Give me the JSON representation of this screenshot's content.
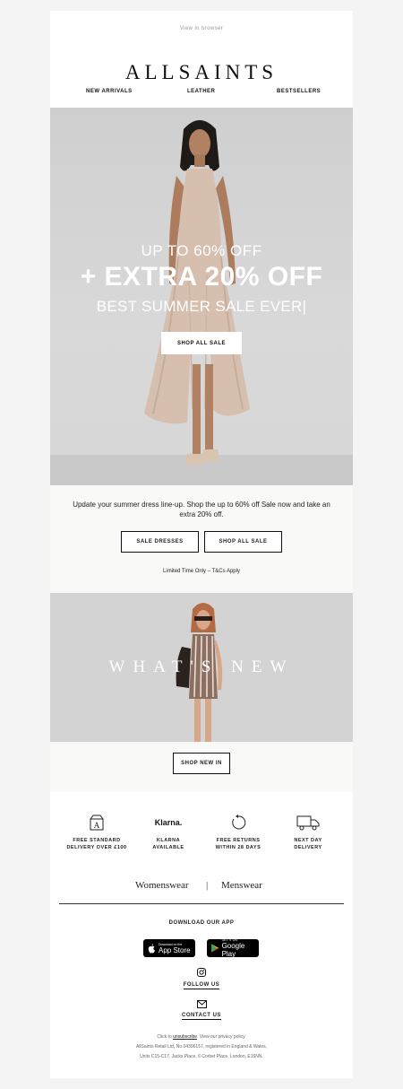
{
  "view_in_browser": "View in browser",
  "brand": "ALLSAINTS",
  "nav": [
    "NEW ARRIVALS",
    "LEATHER",
    "BESTSELLERS"
  ],
  "hero": {
    "line1": "UP TO 60% OFF",
    "line2": "+ EXTRA 20% OFF",
    "line3": "BEST SUMMER SALE EVER|",
    "cta": "SHOP ALL SALE"
  },
  "promo": {
    "copy": "Update your summer dress line-up. Shop the up to 60% off Sale now and take an extra 20% off.",
    "btn_dresses": "SALE DRESSES",
    "btn_all": "SHOP ALL SALE",
    "limited": "Limited Time Only – T&Cs Apply"
  },
  "whats_new": {
    "title": "WHAT'S NEW",
    "cta": "SHOP NEW IN"
  },
  "usps": [
    {
      "icon": "box-a-icon",
      "line1": "FREE STANDARD",
      "line2": "DELIVERY OVER £100"
    },
    {
      "icon": "klarna-logo",
      "logo_text": "Klarna.",
      "line1": "KLARNA",
      "line2": "AVAILABLE"
    },
    {
      "icon": "returns-icon",
      "line1": "FREE RETURNS",
      "line2": "WITHIN 28 DAYS"
    },
    {
      "icon": "truck-icon",
      "line1": "NEXT DAY",
      "line2": "DELIVERY"
    }
  ],
  "gender": {
    "women": "Womenswear",
    "divider": "|",
    "men": "Menswear"
  },
  "app": {
    "heading": "DOWNLOAD OUR APP",
    "appstore_small": "Download on the",
    "appstore_big": "App Store",
    "gplay_small": "GET IT ON",
    "gplay_big": "Google Play"
  },
  "follow": "FOLLOW US",
  "contact": "CONTACT US",
  "footer": {
    "pre": "Click to",
    "unsubscribe": "unsubscribe",
    "post": ". View our privacy policy.",
    "line2": "AllSaints Retail Ltd, No.04396157, registered in England & Wales,",
    "line3": "Units C15-C17, Jacks Place, 6 Corbet Place, London, E16NN."
  },
  "colors": {
    "background": "#f4f4f4",
    "panel": "#ffffff",
    "ink": "#111111"
  }
}
